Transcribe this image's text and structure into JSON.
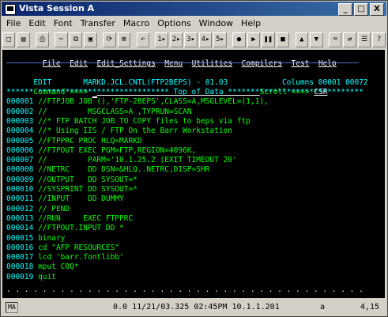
{
  "window": {
    "title": "Vista Session A",
    "controls": [
      "_",
      "□",
      "X"
    ]
  },
  "menu": [
    "File",
    "Edit",
    "Font",
    "Transfer",
    "Macro",
    "Options",
    "Window",
    "Help"
  ],
  "toolbar_icons": [
    {
      "name": "new-icon",
      "glyph": "□"
    },
    {
      "name": "open-icon",
      "glyph": "▤"
    },
    {
      "name": "sep"
    },
    {
      "name": "print-icon",
      "glyph": "⎙"
    },
    {
      "name": "sep"
    },
    {
      "name": "cut-icon",
      "glyph": "✂"
    },
    {
      "name": "copy-icon",
      "glyph": "⧉"
    },
    {
      "name": "paste-icon",
      "glyph": "▣"
    },
    {
      "name": "sep"
    },
    {
      "name": "connect-icon",
      "glyph": "⟳"
    },
    {
      "name": "disconnect-icon",
      "glyph": "⊠"
    },
    {
      "name": "sep"
    },
    {
      "name": "undo-icon",
      "glyph": "↶"
    },
    {
      "name": "sep"
    },
    {
      "name": "macro-1-icon",
      "glyph": "1▸"
    },
    {
      "name": "macro-2-icon",
      "glyph": "2▸"
    },
    {
      "name": "macro-3-icon",
      "glyph": "3▸"
    },
    {
      "name": "macro-4-icon",
      "glyph": "4▸"
    },
    {
      "name": "macro-5-icon",
      "glyph": "5▸"
    },
    {
      "name": "sep"
    },
    {
      "name": "record-icon",
      "glyph": "●"
    },
    {
      "name": "play-icon",
      "glyph": "▶"
    },
    {
      "name": "pause-icon",
      "glyph": "❚❚"
    },
    {
      "name": "stop-icon",
      "glyph": "■"
    },
    {
      "name": "sep"
    },
    {
      "name": "up-icon",
      "glyph": "▲"
    },
    {
      "name": "down-icon",
      "glyph": "▼"
    },
    {
      "name": "sep"
    },
    {
      "name": "keyboard-icon",
      "glyph": "⌨"
    },
    {
      "name": "transfer-icon",
      "glyph": "⇄"
    },
    {
      "name": "settings-icon",
      "glyph": "☰"
    },
    {
      "name": "help-icon",
      "glyph": "?"
    }
  ],
  "terminal": {
    "menu": [
      "File",
      "Edit",
      "Edit_Settings",
      "Menu",
      "Utilities",
      "Compilers",
      "Test",
      "Help"
    ],
    "separator": "──────────────────────────────────────────────────────────────────────────────",
    "edit_label": "EDIT",
    "dataset": "MARKD.JCL.CNTL(FTP2BEPS) - 01.03",
    "columns_label": "Columns",
    "columns_value": "00001 00072",
    "command_label": "Command ===>",
    "scroll_label": "Scroll ===>",
    "scroll_value": "CSR",
    "top_of_data": "****** ***************************** Top of Data ******************************",
    "lines": [
      {
        "num": "000001",
        "text": "//FTPJOB JOB (),'FTP-2BEPS',CLASS=A,MSGLEVEL=(1,1),"
      },
      {
        "num": "000002",
        "text": "//         MSGCLASS=A ,TYPRUN=SCAN"
      },
      {
        "num": "000003",
        "text": "//* FTP BATCH JOB TO COPY files to beps via ftp"
      },
      {
        "num": "000004",
        "text": "//* Using IIS / FTP On the Barr Workstation"
      },
      {
        "num": "000005",
        "text": "//FTPPRC PROC HLQ=MARKD"
      },
      {
        "num": "000006",
        "text": "//FTPOUT EXEC PGM=FTP,REGION=4096K,"
      },
      {
        "num": "000007",
        "text": "//         PARM='10.1.25.2 (EXIT TIMEOUT 20'"
      },
      {
        "num": "000008",
        "text": "//NETRC    DD DSN=&HLQ..NETRC,DISP=SHR"
      },
      {
        "num": "000009",
        "text": "//OUTPUT   DD SYSOUT=*"
      },
      {
        "num": "000010",
        "text": "//SYSPRINT DD SYSOUT=*"
      },
      {
        "num": "000011",
        "text": "//INPUT    DD DUMMY"
      },
      {
        "num": "000012",
        "text": "// PEND"
      },
      {
        "num": "000013",
        "text": "//RUN     EXEC FTPPRC"
      },
      {
        "num": "000014",
        "text": "//FTPOUT.INPUT DD *"
      },
      {
        "num": "000015",
        "text": "binary"
      },
      {
        "num": "000016",
        "text": "cd \"AFP RESOURCES\""
      },
      {
        "num": "000017",
        "text": "lcd 'barr.fontlibb'"
      },
      {
        "num": "000018",
        "text": "mput C0Q*"
      },
      {
        "num": "000019",
        "text": "quit"
      }
    ],
    "dots": ". . . . . . . . . . . . . . . . . . . . . . . . . . . . . . . . . . . . . . . ."
  },
  "status": {
    "left": "MA",
    "info": "0.0 11/21/03.325 02:45PM 10.1.1.201",
    "mode": "a",
    "position": "4,15"
  }
}
